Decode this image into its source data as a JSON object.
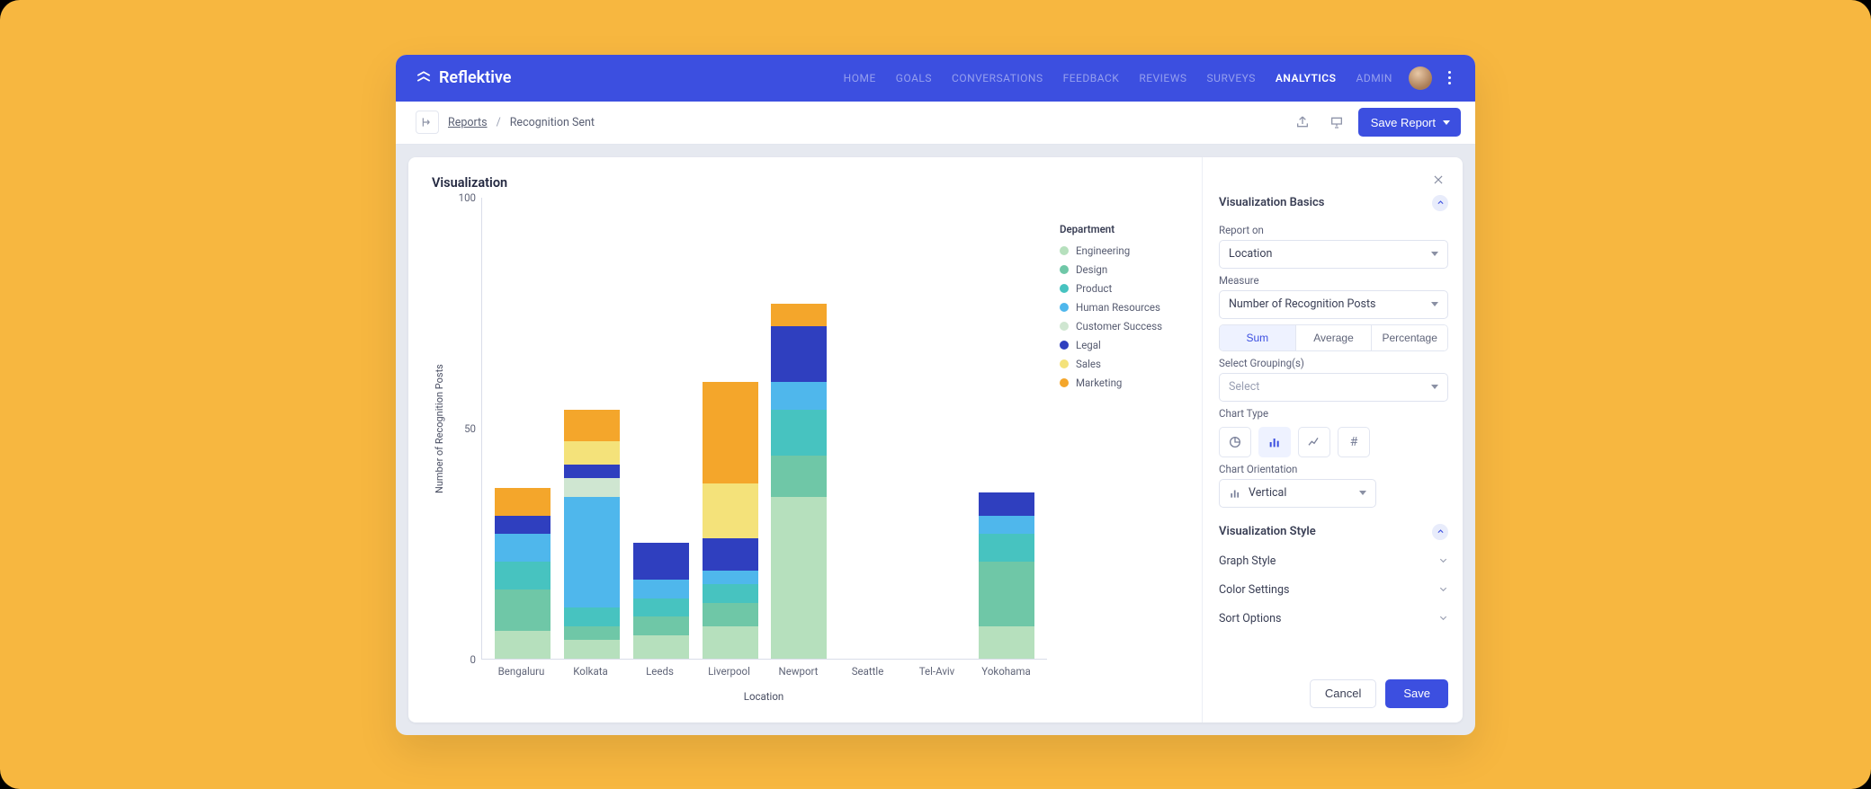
{
  "brand": "Reflektive",
  "nav": {
    "items": [
      "HOME",
      "GOALS",
      "CONVERSATIONS",
      "FEEDBACK",
      "REVIEWS",
      "SURVEYS",
      "ANALYTICS",
      "ADMIN"
    ],
    "active": "ANALYTICS"
  },
  "actionbar": {
    "reports_label": "Reports",
    "crumb_active": "Recognition Sent",
    "save_report": "Save Report"
  },
  "viz": {
    "title": "Visualization",
    "xlabel": "Location",
    "ylabel": "Number of Recognition Posts",
    "legend_title": "Department"
  },
  "legend_series": [
    {
      "name": "Engineering",
      "color": "#b6e0bd"
    },
    {
      "name": "Design",
      "color": "#6fc7a7"
    },
    {
      "name": "Product",
      "color": "#47c3c0"
    },
    {
      "name": "Human Resources",
      "color": "#4fb7ec"
    },
    {
      "name": "Customer Success",
      "color": "#cfe6d1"
    },
    {
      "name": "Legal",
      "color": "#2f3fbf"
    },
    {
      "name": "Sales",
      "color": "#f4e27a"
    },
    {
      "name": "Marketing",
      "color": "#f4a62b"
    }
  ],
  "panel": {
    "basics_title": "Visualization Basics",
    "report_on_label": "Report on",
    "report_on_value": "Location",
    "measure_label": "Measure",
    "measure_value": "Number of Recognition Posts",
    "agg_options": [
      "Sum",
      "Average",
      "Percentage"
    ],
    "agg_active": "Sum",
    "grouping_label": "Select Grouping(s)",
    "grouping_placeholder": "Select",
    "chart_type_label": "Chart Type",
    "orientation_label": "Chart Orientation",
    "orientation_value": "Vertical",
    "style_title": "Visualization Style",
    "style_rows": [
      "Graph Style",
      "Color Settings",
      "Sort Options"
    ],
    "cancel": "Cancel",
    "save": "Save"
  },
  "chart_data": {
    "type": "bar",
    "title": "Visualization",
    "xlabel": "Location",
    "ylabel": "Number of Recognition Posts",
    "ylim": [
      0,
      100
    ],
    "yticks": [
      0,
      50,
      100
    ],
    "categories": [
      "Bengaluru",
      "Kolkata",
      "Leeds",
      "Liverpool",
      "Newport",
      "Seattle",
      "Tel-Aviv",
      "Yokohama"
    ],
    "series": [
      {
        "name": "Engineering",
        "color": "#b6e0bd",
        "values": [
          6,
          4,
          5,
          7,
          35,
          0,
          0,
          7
        ]
      },
      {
        "name": "Design",
        "color": "#6fc7a7",
        "values": [
          9,
          3,
          4,
          5,
          9,
          0,
          0,
          14
        ]
      },
      {
        "name": "Product",
        "color": "#47c3c0",
        "values": [
          6,
          4,
          4,
          4,
          10,
          0,
          0,
          6
        ]
      },
      {
        "name": "Human Resources",
        "color": "#4fb7ec",
        "values": [
          6,
          24,
          4,
          3,
          6,
          0,
          0,
          4
        ]
      },
      {
        "name": "Customer Success",
        "color": "#cfe6d1",
        "values": [
          0,
          4,
          0,
          0,
          0,
          0,
          0,
          0
        ]
      },
      {
        "name": "Legal",
        "color": "#2f3fbf",
        "values": [
          4,
          3,
          8,
          7,
          12,
          0,
          0,
          5
        ]
      },
      {
        "name": "Sales",
        "color": "#f4e27a",
        "values": [
          0,
          5,
          0,
          12,
          0,
          0,
          0,
          0
        ]
      },
      {
        "name": "Marketing",
        "color": "#f4a62b",
        "values": [
          6,
          7,
          0,
          22,
          5,
          0,
          0,
          0
        ]
      }
    ]
  }
}
